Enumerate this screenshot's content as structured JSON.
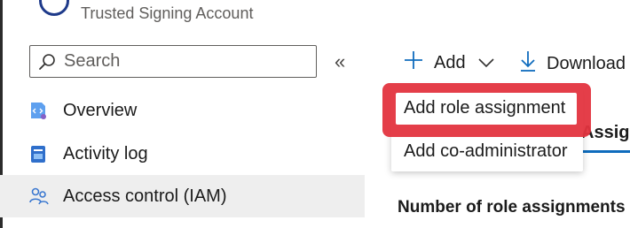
{
  "header": {
    "title": "Trusted Signing Account"
  },
  "search": {
    "placeholder": "Search"
  },
  "sidebar": {
    "collapse_glyph": "«",
    "items": [
      {
        "label": "Overview",
        "icon": "overview-icon"
      },
      {
        "label": "Activity log",
        "icon": "activity-log-icon"
      },
      {
        "label": "Access control (IAM)",
        "icon": "iam-icon",
        "selected": true
      }
    ]
  },
  "toolbar": {
    "add_label": "Add",
    "download_label": "Download"
  },
  "add_menu": {
    "items": [
      {
        "label": "Add role assignment",
        "highlighted": true
      },
      {
        "label": "Add co-administrator"
      }
    ]
  },
  "tab_partial": "Assig",
  "main": {
    "section_heading": "Number of role assignments"
  },
  "colors": {
    "accent": "#0f6cbd",
    "highlight": "#e3343f",
    "selected_bg": "#eeeeee"
  }
}
